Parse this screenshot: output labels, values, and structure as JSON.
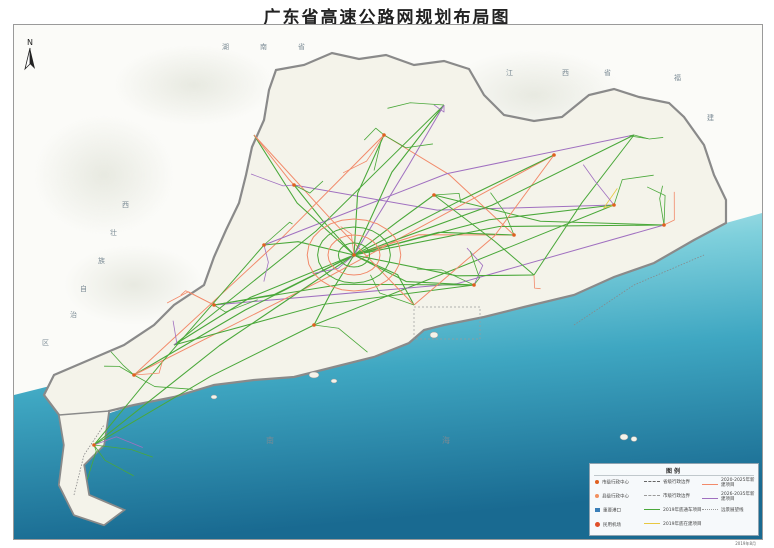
{
  "title": "广东省高速公路网规划布局图",
  "north_label": "N",
  "region_labels": [
    "湖",
    "南",
    "省",
    "江",
    "西",
    "省",
    "福",
    "建",
    "西",
    "壮",
    "族",
    "自",
    "治",
    "区",
    "南",
    "海"
  ],
  "legend": {
    "title": "图例",
    "items": [
      {
        "label": "市级行政中心",
        "kind": "marker",
        "color": "#e06020"
      },
      {
        "label": "省级行政边界",
        "kind": "line",
        "color": "#666666",
        "style": "dash"
      },
      {
        "label": "2020-2025年新建项目",
        "kind": "line",
        "color": "#f28a6a",
        "style": "solid"
      },
      {
        "label": "县级行政中心",
        "kind": "marker",
        "color": "#f29060"
      },
      {
        "label": "市级行政边界",
        "kind": "line",
        "color": "#9a9a9a",
        "style": "dash"
      },
      {
        "label": "2026-2035年新建项目",
        "kind": "line",
        "color": "#a070c0",
        "style": "solid"
      },
      {
        "label": "重要港口",
        "kind": "marker",
        "color": "#3b7fb8"
      },
      {
        "label": "2019年底通车项目",
        "kind": "line",
        "color": "#4aa83a",
        "style": "solid"
      },
      {
        "label": "远景展望线",
        "kind": "line",
        "color": "#999999",
        "style": "dot"
      },
      {
        "label": "民用机场",
        "kind": "marker",
        "color": "#e0502a"
      },
      {
        "label": "2019年底在建项目",
        "kind": "line",
        "color": "#e8c840",
        "style": "solid"
      }
    ]
  },
  "date_text": "2019年8月",
  "colors": {
    "land": "#f6f4ec",
    "outside": "#fbfbf8",
    "sea_deep": "#1d6f95",
    "sea_light": "#c9eef2",
    "road_open": "#4aa83a",
    "road_building": "#e8c840",
    "road_2025": "#f28a6a",
    "road_2035": "#a070c0",
    "boundary": "#7a7a7a"
  }
}
